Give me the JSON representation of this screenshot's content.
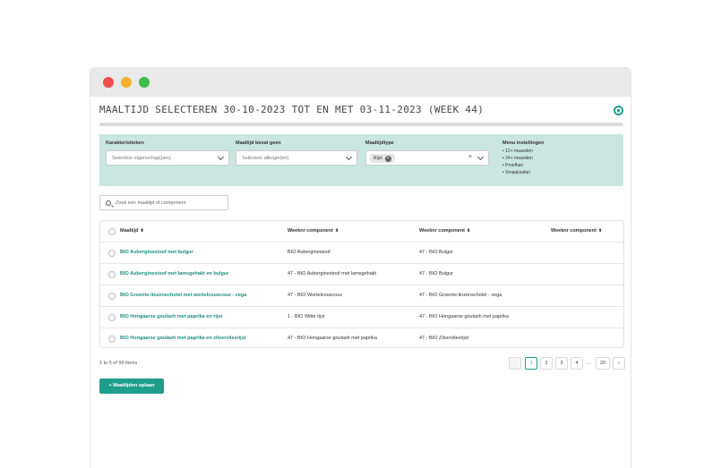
{
  "modal": {
    "title": "Maaltijd selecteren 30-10-2023 tot en met 03-11-2023 (week 44)"
  },
  "filters": {
    "characteristics": {
      "label": "Karakteristieken",
      "placeholder": "Selecteer eigenschap(pen)"
    },
    "allergens": {
      "label": "Maaltijd bevat geen",
      "placeholder": "Selecteer allergie(en)"
    },
    "meal_type": {
      "label": "Maaltijdtype",
      "selected_tag": "Rijst"
    },
    "menu_settings": {
      "title": "Menu instellingen",
      "items": [
        "12+ maanden",
        "24+ maanden",
        "Proeftuin",
        "Smaaksafari"
      ]
    }
  },
  "search": {
    "placeholder": "Zoek een maaltijd of component"
  },
  "table": {
    "headers": [
      "Maaltijd",
      "Weeknr component",
      "Weeknr component",
      "Weeknr component"
    ],
    "rows": [
      [
        "BIO Auberginestoof met bulgur",
        "BIO Auberginestoof",
        "47 - BIO Bulgur",
        ""
      ],
      [
        "BIO Auberginestoof met lamsgehakt en bulgur",
        "47 - BIO Auberginestoof met lamsgehakt",
        "47 - BIO Bulgur",
        ""
      ],
      [
        "BIO Groente-linzenschotel met wortelcouscous - vega",
        "47 - BIO Wortelcouscous",
        "47 - BIO Groente-linzenschotel - vega",
        ""
      ],
      [
        "BIO Hongaarse goulash met paprika en rijst",
        "1 - BIO Witte rijst",
        "47 - BIO Hongaarse goulash met paprika",
        ""
      ],
      [
        "BIO Hongaarse goulash met paprika en zilvervliesrijst",
        "47 - BIO Hongaarse goulash met paprika",
        "47 - BIO Zilvervliesrijst",
        ""
      ]
    ]
  },
  "pagination": {
    "summary": "1 to 5 of 99 items",
    "prev": "‹",
    "pages": [
      "1",
      "2",
      "3",
      "4"
    ],
    "ellipsis": "...",
    "last": "20",
    "next": "›",
    "active_page": "1"
  },
  "actions": {
    "plan_button": "+ Maaltijden oplaan"
  },
  "colors": {
    "accent": "#1f9e8c",
    "filter_bg": "#c9e6e0"
  },
  "icons": {
    "close": "close-circle-icon",
    "search": "search-icon",
    "sort": "sort-icon",
    "chevron": "chevron-down-icon"
  }
}
